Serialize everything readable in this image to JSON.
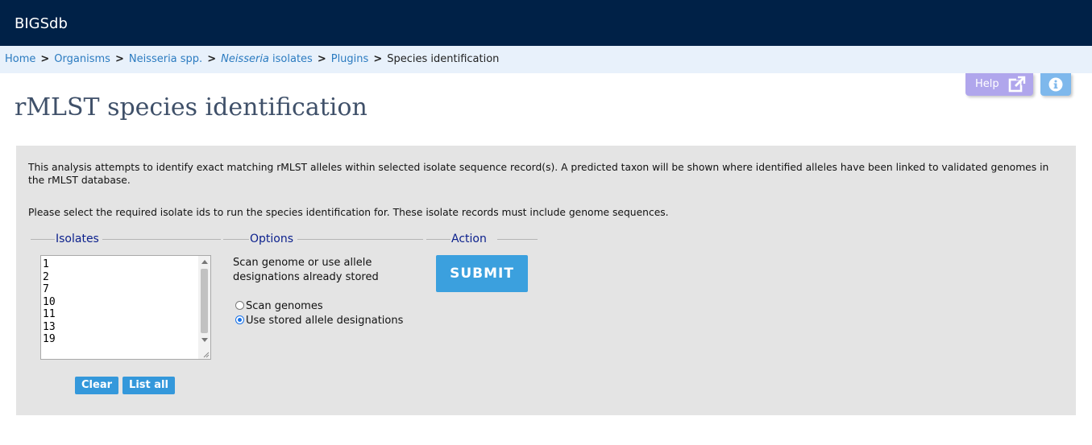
{
  "app": {
    "name": "BIGSdb"
  },
  "breadcrumb": {
    "items": [
      "Home",
      "Organisms",
      "Neisseria spp."
    ],
    "isolates_italic": "Neisseria",
    "isolates_rest": " isolates",
    "plugins": "Plugins",
    "current": "Species identification",
    "separator": ">"
  },
  "header_buttons": {
    "help": "Help"
  },
  "page": {
    "title": "rMLST species identification"
  },
  "description": {
    "line1": "This analysis attempts to identify exact matching rMLST alleles within selected isolate sequence record(s). A predicted taxon will be shown where identified alleles have been linked to validated genomes in the rMLST database.",
    "line2": "Please select the required isolate ids to run the species identification for. These isolate records must include genome sequences."
  },
  "isolates": {
    "legend": "Isolates",
    "ids": [
      "1",
      "2",
      "7",
      "10",
      "11",
      "13",
      "19"
    ],
    "clear_label": "Clear",
    "list_all_label": "List all"
  },
  "options": {
    "legend": "Options",
    "prompt": "Scan genome or use allele designations already stored",
    "radios": [
      {
        "label": "Scan genomes",
        "checked": false
      },
      {
        "label": "Use stored allele designations",
        "checked": true
      }
    ]
  },
  "action": {
    "legend": "Action",
    "submit_label": "SUBMIT"
  },
  "colors": {
    "topbar": "#002147",
    "crumbbar": "#e8f1fb",
    "link": "#2b7bc0",
    "title": "#3f5069",
    "legend": "#0a1f8c",
    "button": "#3498db",
    "help": "#b0a6ec",
    "info": "#7eb8ec"
  },
  "icons": {
    "help": "external-link-icon",
    "info": "info-circle-icon",
    "resize": "resize-grip-icon"
  }
}
